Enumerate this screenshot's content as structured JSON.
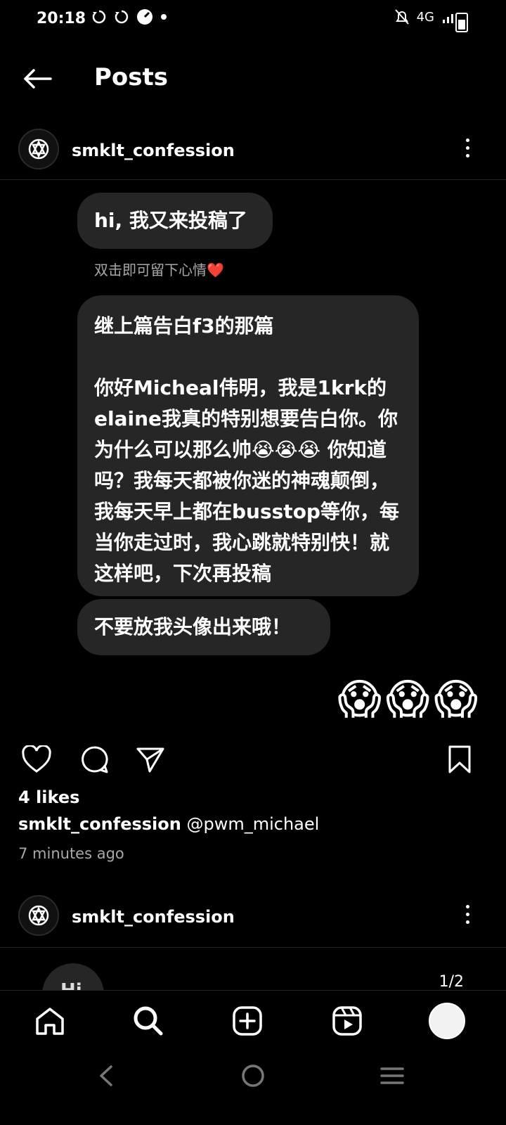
{
  "status_bar": {
    "time": "20:18",
    "network": "4G",
    "icons": [
      "sync-icon",
      "sync-icon",
      "speed-icon",
      "dot-icon",
      "mute-bell-icon",
      "signal-icon",
      "battery-icon"
    ]
  },
  "header": {
    "title": "Posts",
    "back_icon": "arrow-left-icon"
  },
  "post1": {
    "username": "smklt_confession",
    "messages": [
      "hi, 我又来投稿了",
      "继上篇告白f3的那篇\n\n你好Micheal伟明，我是1krk的elaine我真的特别想要告白你。你为什么可以那么帅😭😭😭 你知道吗？我每天都被你迷的神魂颠倒，我每天早上都在busstop等你，每当你走过时，我心跳就特别快！就这样吧，下次再投稿",
      "不要放我头像出来哦！"
    ],
    "reaction_hint": "双击即可留下心情❤️",
    "reaction_emojis": "😱😱😱",
    "likes": "4 likes",
    "caption_user": "smklt_confession",
    "caption_text": " @pwm_michael",
    "time_ago": "7 minutes ago"
  },
  "post2": {
    "username": "smklt_confession",
    "preview_text": "Hi",
    "page_counter": "1/2"
  },
  "bottom_nav": {
    "items": [
      "home-icon",
      "search-icon",
      "create-icon",
      "reels-icon",
      "profile-avatar"
    ]
  },
  "system_nav": {
    "items": [
      "back-icon",
      "home-circle-icon",
      "recents-icon"
    ]
  },
  "colors": {
    "background": "#000000",
    "bubble": "#262626",
    "muted_text": "#a8a8a8",
    "heart": "#ff3040"
  }
}
